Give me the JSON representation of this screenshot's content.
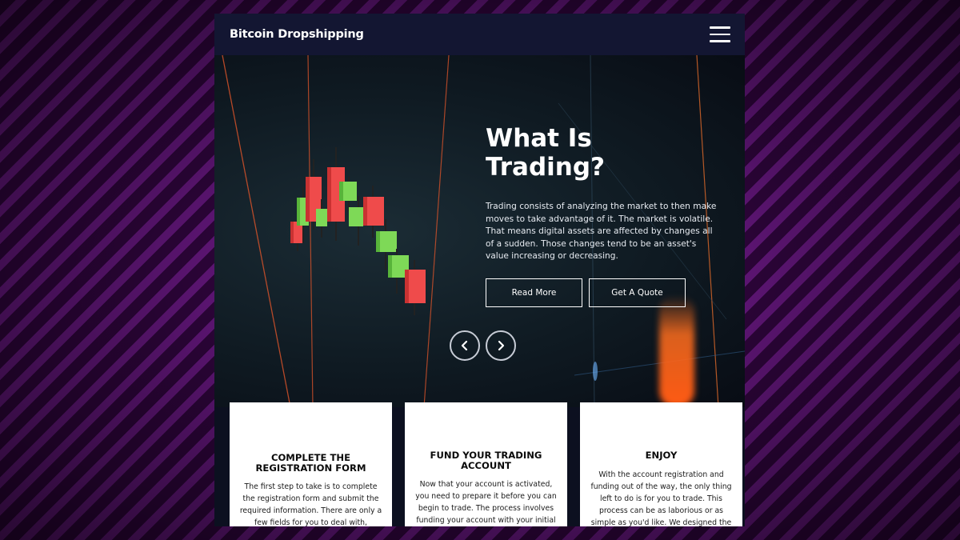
{
  "header": {
    "brand": "Bitcoin Dropshipping",
    "menu_icon": "hamburger-menu-icon"
  },
  "hero": {
    "title": "What Is Trading?",
    "text": "Trading consists of analyzing the market to then make moves to take advantage of it. The market is volatile. That means digital assets are affected by changes all of a sudden. Those changes tend to be an asset's value increasing or decreasing.",
    "read_more_label": "Read More",
    "quote_label": "Get A Quote",
    "prev_icon": "chevron-left-icon",
    "next_icon": "chevron-right-icon"
  },
  "cards": [
    {
      "title": "COMPLETE THE REGISTRATION FORM",
      "text": "The first step to take is to complete the registration form and submit the required information. There are only a few fields for you to deal with, reinforcing our point"
    },
    {
      "title": "FUND YOUR TRADING ACCOUNT",
      "text": "Now that your account is activated, you need to prepare it before you can begin to trade. The process involves funding your account with your initial investment."
    },
    {
      "title": "ENJOY",
      "text": "With the account registration and funding out of the way, the only thing left to do is for you to trade. This process can be as laborious or as simple as you'd like. We designed the Bitcoin Revolution app to"
    }
  ],
  "colors": {
    "background_purple": "#3a0a4c",
    "navbar": "#131632",
    "candle_green": "#7ed957",
    "candle_red": "#ef4b4b",
    "accent_orange": "#ff5a14"
  }
}
